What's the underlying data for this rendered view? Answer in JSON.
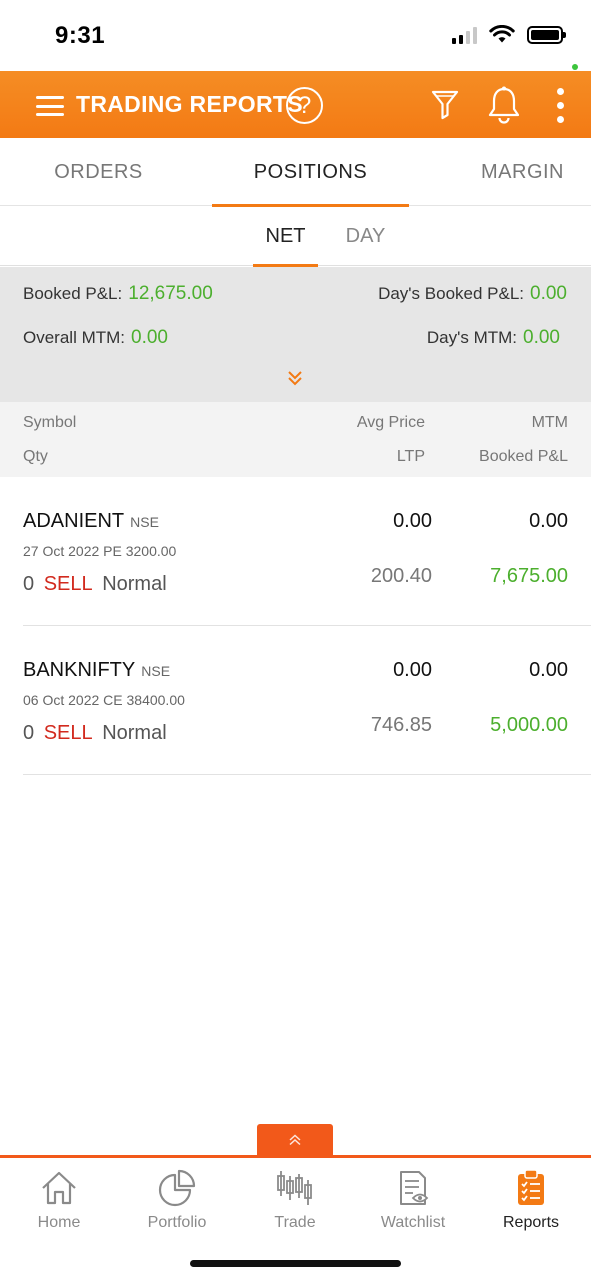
{
  "status_bar": {
    "time": "9:31"
  },
  "header": {
    "title": "TRADING REPORTS",
    "help_symbol": "?"
  },
  "main_tabs": [
    {
      "label": "ORDERS",
      "active": false
    },
    {
      "label": "POSITIONS",
      "active": true
    },
    {
      "label": "MARGIN",
      "active": false
    }
  ],
  "sub_tabs": [
    {
      "label": "NET",
      "active": true
    },
    {
      "label": "DAY",
      "active": false
    }
  ],
  "summary": {
    "booked_pnl_label": "Booked P&L:",
    "booked_pnl_value": "12,675.00",
    "days_booked_pnl_label": "Day's Booked P&L:",
    "days_booked_pnl_value": "0.00",
    "overall_mtm_label": "Overall MTM:",
    "overall_mtm_value": "0.00",
    "days_mtm_label": "Day's MTM:",
    "days_mtm_value": "0.00"
  },
  "columns": {
    "symbol": "Symbol",
    "avg_price": "Avg Price",
    "mtm": "MTM",
    "qty": "Qty",
    "ltp": "LTP",
    "booked_pnl": "Booked P&L"
  },
  "positions": [
    {
      "symbol": "ADANIENT",
      "exchange": "NSE",
      "contract": "27 Oct 2022 PE 3200.00",
      "qty": "0",
      "side": "SELL",
      "product": "Normal",
      "avg_price": "0.00",
      "mtm": "0.00",
      "ltp": "200.40",
      "booked_pnl": "7,675.00"
    },
    {
      "symbol": "BANKNIFTY",
      "exchange": "NSE",
      "contract": "06 Oct 2022 CE 38400.00",
      "qty": "0",
      "side": "SELL",
      "product": "Normal",
      "avg_price": "0.00",
      "mtm": "0.00",
      "ltp": "746.85",
      "booked_pnl": "5,000.00"
    }
  ],
  "bottom_nav": [
    {
      "label": "Home",
      "icon": "home-icon",
      "active": false
    },
    {
      "label": "Portfolio",
      "icon": "pie-chart-icon",
      "active": false
    },
    {
      "label": "Trade",
      "icon": "candlestick-icon",
      "active": false
    },
    {
      "label": "Watchlist",
      "icon": "watchlist-icon",
      "active": false
    },
    {
      "label": "Reports",
      "icon": "clipboard-icon",
      "active": true
    }
  ],
  "colors": {
    "brand_orange": "#f37a14",
    "accent_red_orange": "#f2591a",
    "profit_green": "#4caf2e",
    "sell_red": "#d22a1e"
  }
}
